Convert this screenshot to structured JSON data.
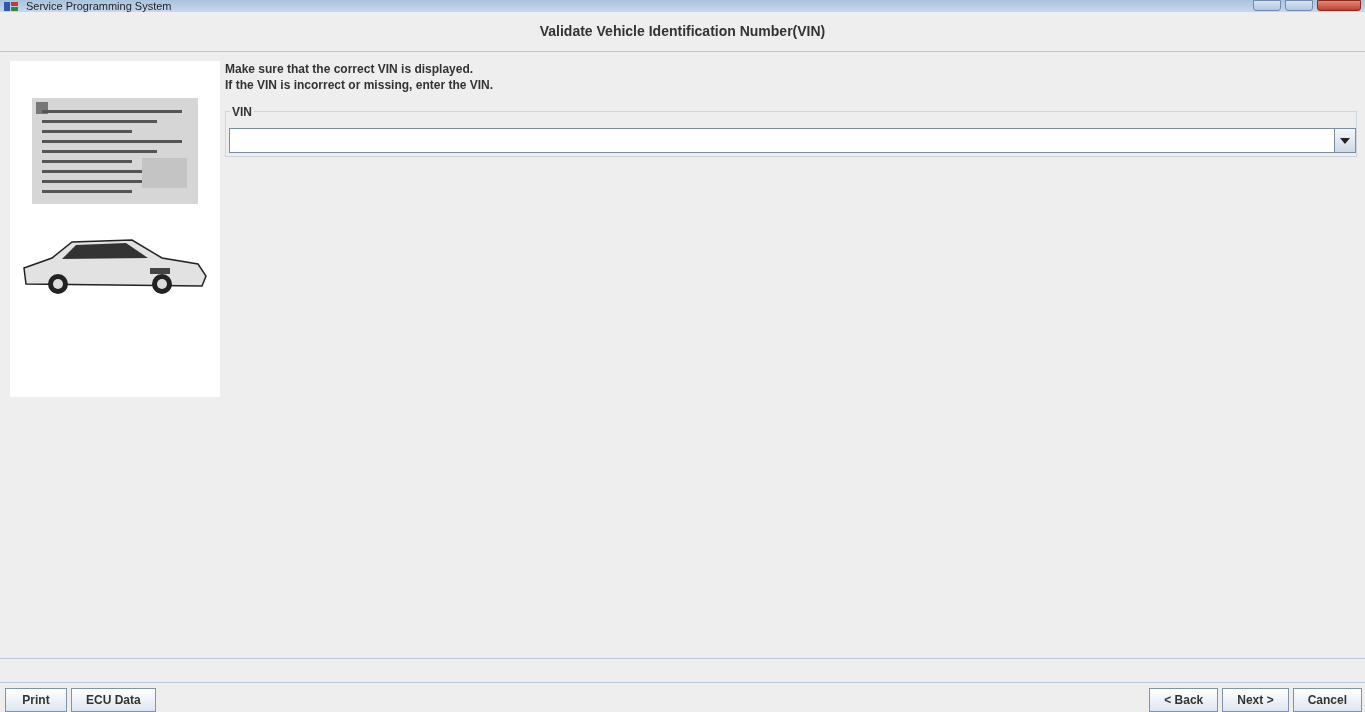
{
  "window": {
    "title": "Service Programming System"
  },
  "heading": "Validate Vehicle Identification Number(VIN)",
  "illustration": {
    "kind": "picture"
  },
  "instructions": [
    "Make sure that the correct VIN is displayed.",
    "If the VIN is incorrect or missing, enter the VIN."
  ],
  "vin_group": {
    "label": "VIN"
  },
  "left_buttons": [
    "Print",
    "ECU Data"
  ],
  "right_buttons": [
    "< Back",
    "Next >",
    "Cancel"
  ]
}
